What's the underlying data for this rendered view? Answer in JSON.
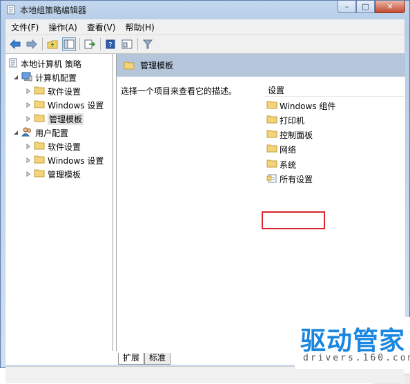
{
  "window": {
    "title": "本地组策略编辑器"
  },
  "caption_buttons": {
    "minimize": "–",
    "maximize": "□",
    "close": "✕"
  },
  "menu": [
    "文件(F)",
    "操作(A)",
    "查看(V)",
    "帮助(H)"
  ],
  "tree": {
    "root": "本地计算机 策略",
    "computer": {
      "label": "计算机配置",
      "children": [
        "软件设置",
        "Windows 设置",
        "管理模板"
      ]
    },
    "user": {
      "label": "用户配置",
      "children": [
        "软件设置",
        "Windows 设置",
        "管理模板"
      ]
    }
  },
  "right_pane": {
    "header": "管理模板",
    "description": "选择一个项目来查看它的描述。",
    "column_header": "设置",
    "items": [
      "Windows 组件",
      "打印机",
      "控制面板",
      "网络",
      "系统",
      "所有设置"
    ]
  },
  "tabs": [
    "扩展",
    "标准"
  ],
  "watermark": {
    "brand": "驱动管家",
    "url": "drivers.160.com"
  }
}
